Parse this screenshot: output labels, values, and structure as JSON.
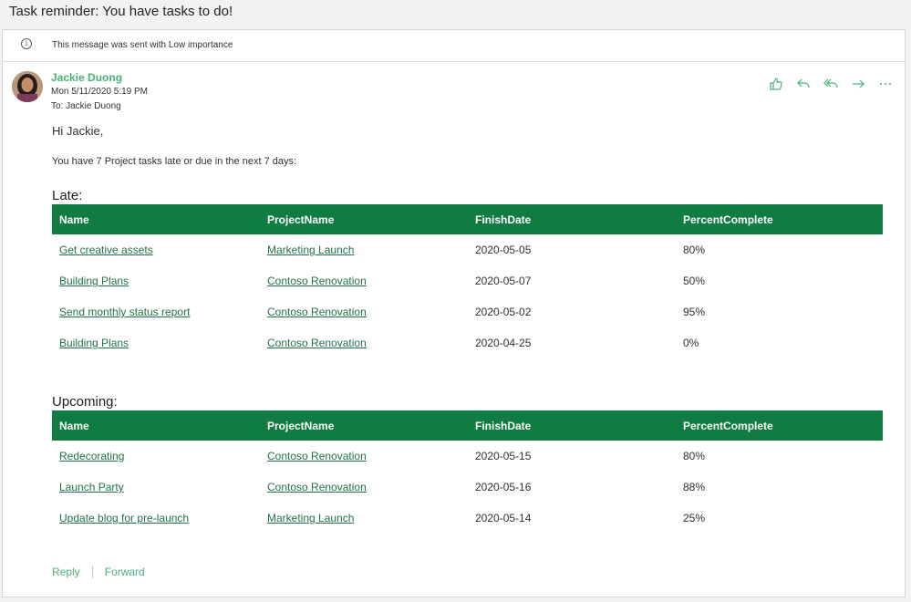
{
  "email": {
    "subject": "Task reminder: You have tasks to do!",
    "importance_text": "This message was sent with Low importance",
    "sender": "Jackie Duong",
    "sent_at": "Mon 5/11/2020 5:19 PM",
    "to_label": "To:",
    "to_name": "Jackie Duong",
    "greeting": "Hi Jackie,",
    "summary": "You have 7 Project tasks late or due in the next 7 days:"
  },
  "actions": [
    {
      "name": "like-button",
      "icon": "thumbs-up-icon"
    },
    {
      "name": "reply-button",
      "icon": "reply-icon"
    },
    {
      "name": "reply-all-button",
      "icon": "reply-all-icon"
    },
    {
      "name": "forward-button",
      "icon": "forward-icon"
    },
    {
      "name": "more-actions-button",
      "icon": "more-icon"
    }
  ],
  "table_headers": [
    "Name",
    "ProjectName",
    "FinishDate",
    "PercentComplete"
  ],
  "late": {
    "title": "Late:",
    "rows": [
      {
        "name": "Get creative assets",
        "project": "Marketing Launch",
        "finish": "2020-05-05",
        "percent": "80%"
      },
      {
        "name": "Building Plans",
        "project": "Contoso Renovation",
        "finish": "2020-05-07",
        "percent": "50%"
      },
      {
        "name": "Send monthly status report",
        "project": "Contoso Renovation",
        "finish": "2020-05-02",
        "percent": "95%"
      },
      {
        "name": "Building Plans",
        "project": "Contoso Renovation",
        "finish": "2020-04-25",
        "percent": "0%"
      }
    ]
  },
  "upcoming": {
    "title": "Upcoming:",
    "rows": [
      {
        "name": "Redecorating",
        "project": "Contoso Renovation",
        "finish": "2020-05-15",
        "percent": "80%"
      },
      {
        "name": "Launch Party",
        "project": "Contoso Renovation",
        "finish": "2020-05-16",
        "percent": "88%"
      },
      {
        "name": "Update blog for pre-launch",
        "project": "Marketing Launch",
        "finish": "2020-05-14",
        "percent": "25%"
      }
    ]
  },
  "footer": {
    "reply": "Reply",
    "forward": "Forward"
  },
  "colors": {
    "accent": "#107c41",
    "link": "#217346",
    "sender": "#4caf7a"
  }
}
